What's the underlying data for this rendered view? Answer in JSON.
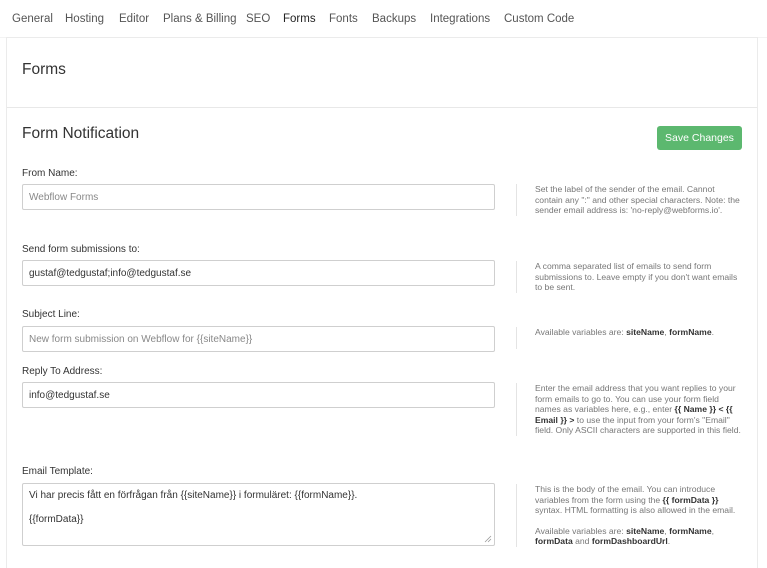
{
  "tabs": [
    {
      "label": "General",
      "active": false
    },
    {
      "label": "Hosting",
      "active": false
    },
    {
      "label": "Editor",
      "active": false
    },
    {
      "label": "Plans & Billing",
      "active": false
    },
    {
      "label": "SEO",
      "active": false
    },
    {
      "label": "Forms",
      "active": true
    },
    {
      "label": "Fonts",
      "active": false
    },
    {
      "label": "Backups",
      "active": false
    },
    {
      "label": "Integrations",
      "active": false
    },
    {
      "label": "Custom Code",
      "active": false
    }
  ],
  "page_title": "Forms",
  "section": {
    "title": "Form Notification",
    "save_label": "Save Changes"
  },
  "colors": {
    "save_button": "#5cb86f",
    "accent_text": "#333333",
    "help_text": "#777777"
  },
  "fields": {
    "from_name": {
      "label": "From Name:",
      "value": "Webflow Forms",
      "help_text": "Set the label of the sender of the email. Cannot contain any \":\" and other special characters. Note: the sender email address is: 'no-reply@webforms.io'."
    },
    "send_to": {
      "label": "Send form submissions to:",
      "value": "gustaf@tedgustaf;info@tedgustaf.se",
      "help_text": "A comma separated list of emails to send form submissions to. Leave empty if you don't want emails to be sent."
    },
    "subject": {
      "label": "Subject Line:",
      "value": "New form submission on Webflow for {{siteName}}",
      "help_prefix": "Available variables are: ",
      "help_var1": "siteName",
      "help_sep": ", ",
      "help_var2": "formName",
      "help_suffix": "."
    },
    "reply_to": {
      "label": "Reply To Address:",
      "value": "info@tedgustaf.se",
      "help_part1": "Enter the email address that you want replies to your form emails to go to. You can use your form field names as variables here, e.g., enter ",
      "help_bold1": "{{ Name }} < {{ Email }} >",
      "help_part2": " to use the input from your form's \"Email\" field. Only ASCII characters are supported in this field."
    },
    "email_template": {
      "label": "Email Template:",
      "line1": "Vi har precis fått en förfrågan från {{siteName}} i formuläret: {{formName}}.",
      "line2": "{{formData}}",
      "help_part1": "This is the body of the email. You can introduce variables from the form using the ",
      "help_bold1": "{{ formData }}",
      "help_part2": " syntax. HTML formatting is also allowed in the email.",
      "vars_prefix": "Available variables are: ",
      "var1": "siteName",
      "sep1": ", ",
      "var2": "formName",
      "sep2": ", ",
      "var3": "formData",
      "and_word": " and ",
      "var4": "formDashboardUrl",
      "vars_suffix": "."
    }
  }
}
